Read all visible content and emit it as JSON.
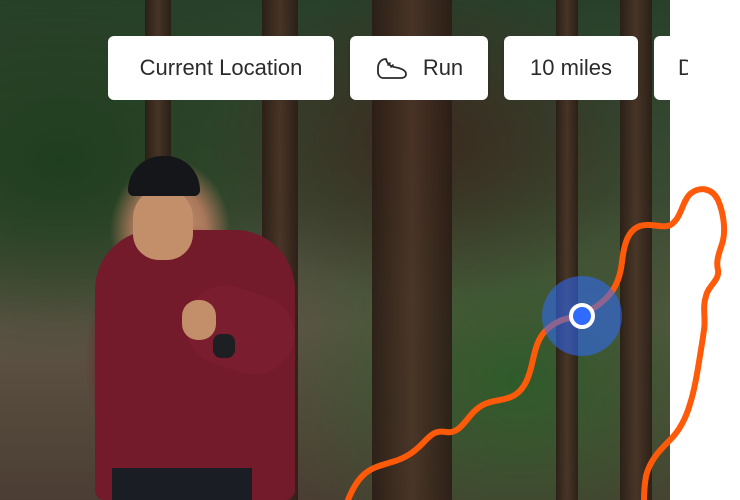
{
  "filters": [
    {
      "label": "Current Location"
    },
    {
      "label": "Run",
      "icon": "shoe-icon"
    },
    {
      "label": "10 miles"
    },
    {
      "label": "Dirt"
    }
  ],
  "map": {
    "route_color": "#ff5a0a",
    "location_color": "#2f6bff",
    "location_halo_color": "#2f6bff"
  }
}
